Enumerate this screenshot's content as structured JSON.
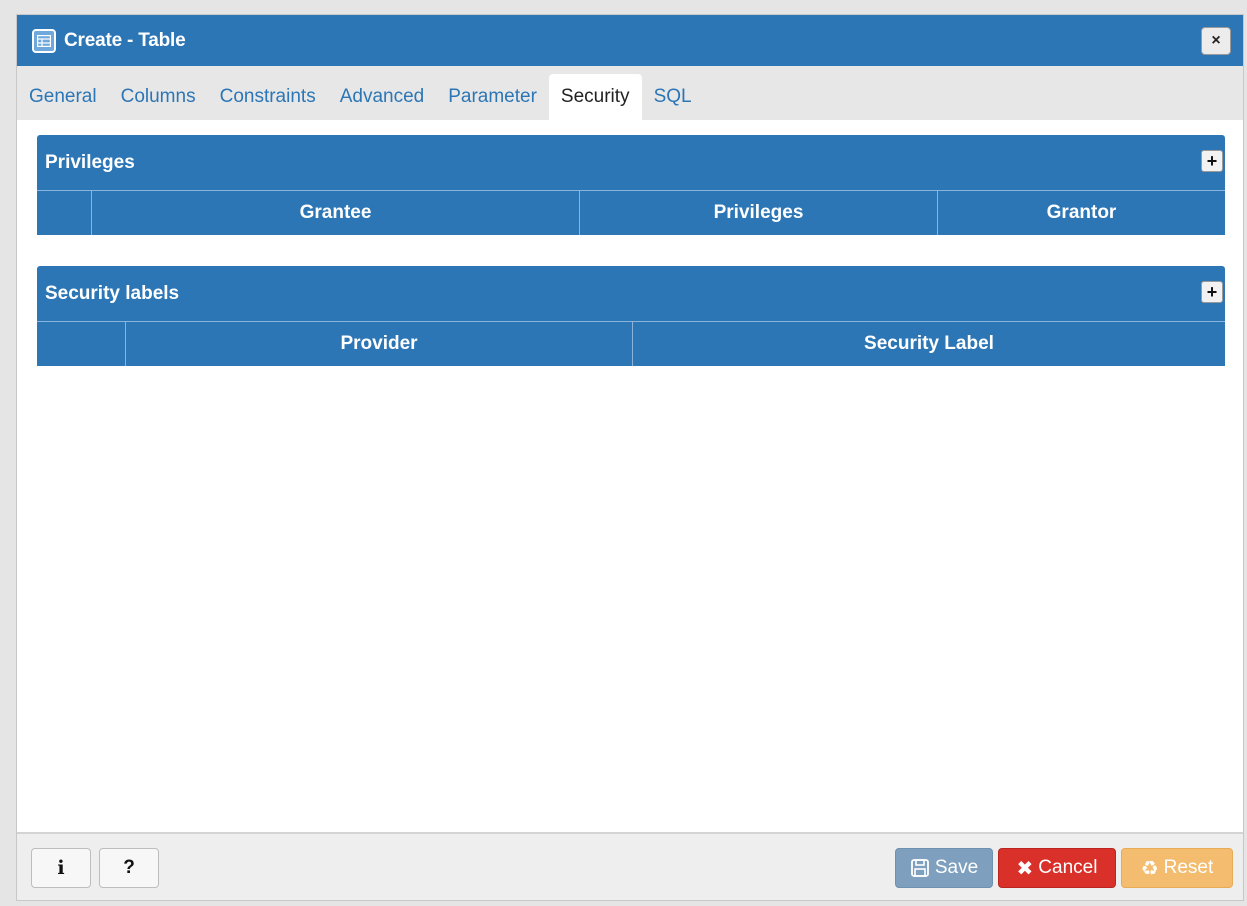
{
  "window": {
    "title": "Create - Table"
  },
  "tabs": [
    {
      "label": "General"
    },
    {
      "label": "Columns"
    },
    {
      "label": "Constraints"
    },
    {
      "label": "Advanced"
    },
    {
      "label": "Parameter"
    },
    {
      "label": "Security",
      "active": true
    },
    {
      "label": "SQL"
    }
  ],
  "privileges": {
    "title": "Privileges",
    "columns": [
      "Grantee",
      "Privileges",
      "Grantor"
    ]
  },
  "security_labels": {
    "title": "Security labels",
    "columns": [
      "Provider",
      "Security Label"
    ]
  },
  "footer": {
    "info_label": "i",
    "help_label": "?",
    "save_label": "Save",
    "cancel_label": "Cancel",
    "reset_label": "Reset"
  },
  "colors": {
    "accent": "#2c76b6",
    "cancel": "#d9302a",
    "save": "#7e9fbd",
    "reset": "#f3bc6e"
  },
  "icons": {
    "title": "table-icon",
    "close": "close-icon",
    "add": "plus-icon",
    "save": "floppy-disk-icon",
    "cancel": "x-icon",
    "reset": "recycle-icon"
  }
}
